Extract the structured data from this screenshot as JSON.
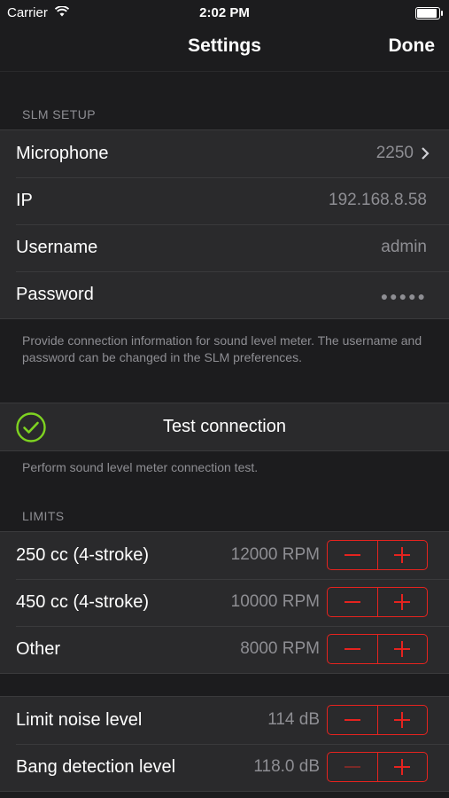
{
  "status_bar": {
    "carrier": "Carrier",
    "time": "2:02 PM"
  },
  "nav": {
    "title": "Settings",
    "done": "Done"
  },
  "slm_setup": {
    "header": "SLM SETUP",
    "rows": [
      {
        "label": "Microphone",
        "value": "2250"
      },
      {
        "label": "IP",
        "value": "192.168.8.58"
      },
      {
        "label": "Username",
        "value": "admin"
      },
      {
        "label": "Password",
        "value": "●●●●●"
      }
    ],
    "footer": "Provide connection information for sound level meter. The username and password can be changed in the SLM preferences."
  },
  "test": {
    "label": "Test connection",
    "footer": "Perform sound level meter connection test."
  },
  "limits": {
    "header": "LIMITS",
    "rows": [
      {
        "label": "250 cc (4-stroke)",
        "value": "12000 RPM"
      },
      {
        "label": "450 cc (4-stroke)",
        "value": "10000 RPM"
      },
      {
        "label": "Other",
        "value": "8000 RPM"
      }
    ]
  },
  "levels": {
    "rows": [
      {
        "label": "Limit noise level",
        "value": "114 dB"
      },
      {
        "label": "Bang detection level",
        "value": "118.0 dB"
      }
    ]
  },
  "colors": {
    "accent": "#e5231f",
    "check": "#7ed321"
  }
}
